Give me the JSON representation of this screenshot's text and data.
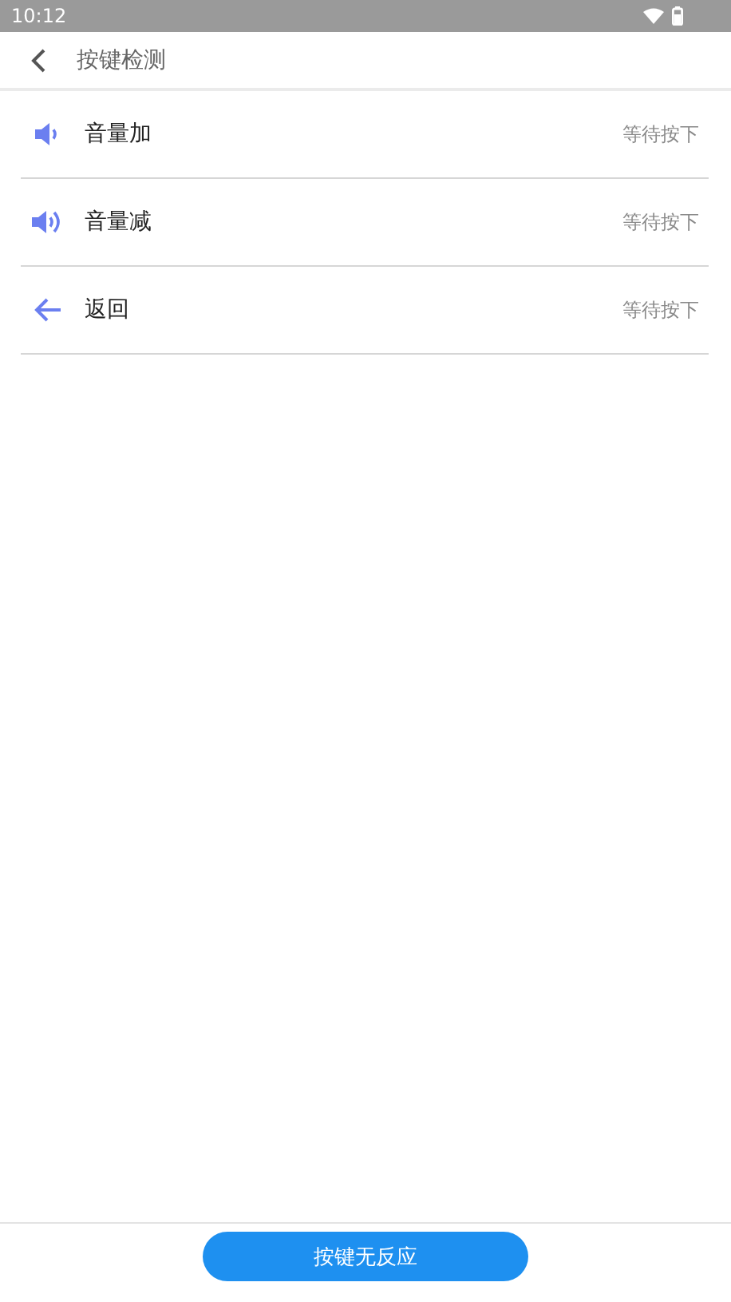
{
  "status_bar": {
    "time": "10:12"
  },
  "header": {
    "title": "按键检测"
  },
  "keys": [
    {
      "kind": "volume-low",
      "label": "音量加",
      "status": "等待按下"
    },
    {
      "kind": "volume-high",
      "label": "音量减",
      "status": "等待按下"
    },
    {
      "kind": "back",
      "label": "返回",
      "status": "等待按下"
    }
  ],
  "footer": {
    "button": "按键无反应"
  }
}
